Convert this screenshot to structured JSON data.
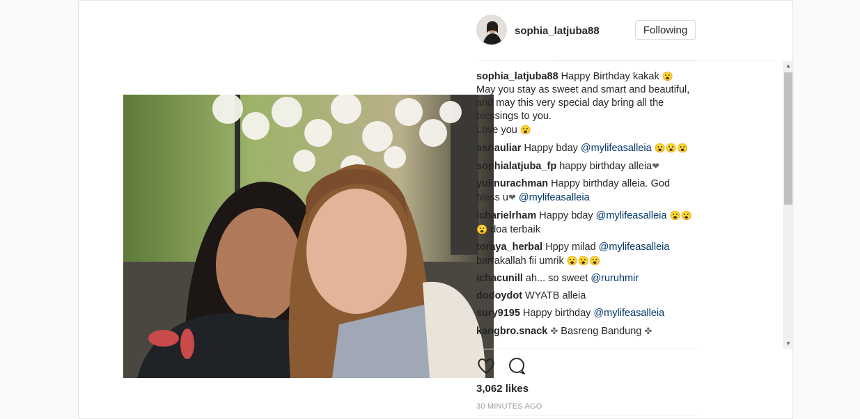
{
  "post": {
    "username": "sophia_latjuba88",
    "follow_label": "Following",
    "likes": "3,062 likes",
    "timestamp": "30 MINUTES AGO"
  },
  "icons": {
    "like": "heart-outline-icon",
    "comment": "speech-bubble-icon",
    "emoji": "smiling-face-emoji",
    "heart_emoji": "black-heart-emoji",
    "flower_emoji": "four-leaf-emoji"
  },
  "comments": [
    {
      "author": "sophia_latjuba88",
      "parts": [
        {
          "t": "text",
          "v": "Happy Birthday kakak "
        },
        {
          "t": "emoji",
          "v": "😮"
        },
        {
          "t": "br"
        },
        {
          "t": "text",
          "v": "May you stay as sweet and smart and beautiful, and may this very special day bring all the blessings to you."
        },
        {
          "t": "br"
        },
        {
          "t": "text",
          "v": "Love you "
        },
        {
          "t": "emoji",
          "v": "😮"
        }
      ]
    },
    {
      "author": "asriauliar",
      "parts": [
        {
          "t": "text",
          "v": "Happy bday "
        },
        {
          "t": "mention",
          "v": "@mylifeasalleia"
        },
        {
          "t": "text",
          "v": " "
        },
        {
          "t": "emoji",
          "v": "😮😮😮"
        }
      ]
    },
    {
      "author": "sophialatjuba_fp",
      "parts": [
        {
          "t": "text",
          "v": "happy birthday alleia"
        },
        {
          "t": "emoji",
          "v": "❤"
        }
      ]
    },
    {
      "author": "yulinurachman",
      "parts": [
        {
          "t": "text",
          "v": "Happy birthday alleia. God bless u"
        },
        {
          "t": "emoji",
          "v": "❤"
        },
        {
          "t": "text",
          "v": " "
        },
        {
          "t": "mention",
          "v": "@mylifeasalleia"
        }
      ]
    },
    {
      "author": "icharielrham",
      "parts": [
        {
          "t": "text",
          "v": "Happy bday "
        },
        {
          "t": "mention",
          "v": "@mylifeasalleia"
        },
        {
          "t": "text",
          "v": " "
        },
        {
          "t": "emoji",
          "v": "😮😮😮"
        },
        {
          "t": "text",
          "v": " doa terbaik"
        }
      ]
    },
    {
      "author": "toraya_herbal",
      "parts": [
        {
          "t": "text",
          "v": "Hppy milad "
        },
        {
          "t": "mention",
          "v": "@mylifeasalleia"
        },
        {
          "t": "text",
          "v": " barrakallah fii umrik "
        },
        {
          "t": "emoji",
          "v": "😮😮😮"
        }
      ]
    },
    {
      "author": "ichacunill",
      "parts": [
        {
          "t": "text",
          "v": "ah... so sweet "
        },
        {
          "t": "mention",
          "v": "@ruruhmir"
        }
      ]
    },
    {
      "author": "dodoydot",
      "parts": [
        {
          "t": "text",
          "v": "WYATB alleia"
        }
      ]
    },
    {
      "author": "sury9195",
      "parts": [
        {
          "t": "text",
          "v": "Happy birthday "
        },
        {
          "t": "mention",
          "v": "@mylifeasalleia"
        }
      ]
    },
    {
      "author": "kangbro.snack",
      "parts": [
        {
          "t": "emoji",
          "v": "✤"
        },
        {
          "t": "text",
          "v": " Basreng Bandung "
        },
        {
          "t": "emoji",
          "v": "✤"
        }
      ]
    }
  ],
  "scrollbar": {
    "up": "▲",
    "down": "▼"
  }
}
